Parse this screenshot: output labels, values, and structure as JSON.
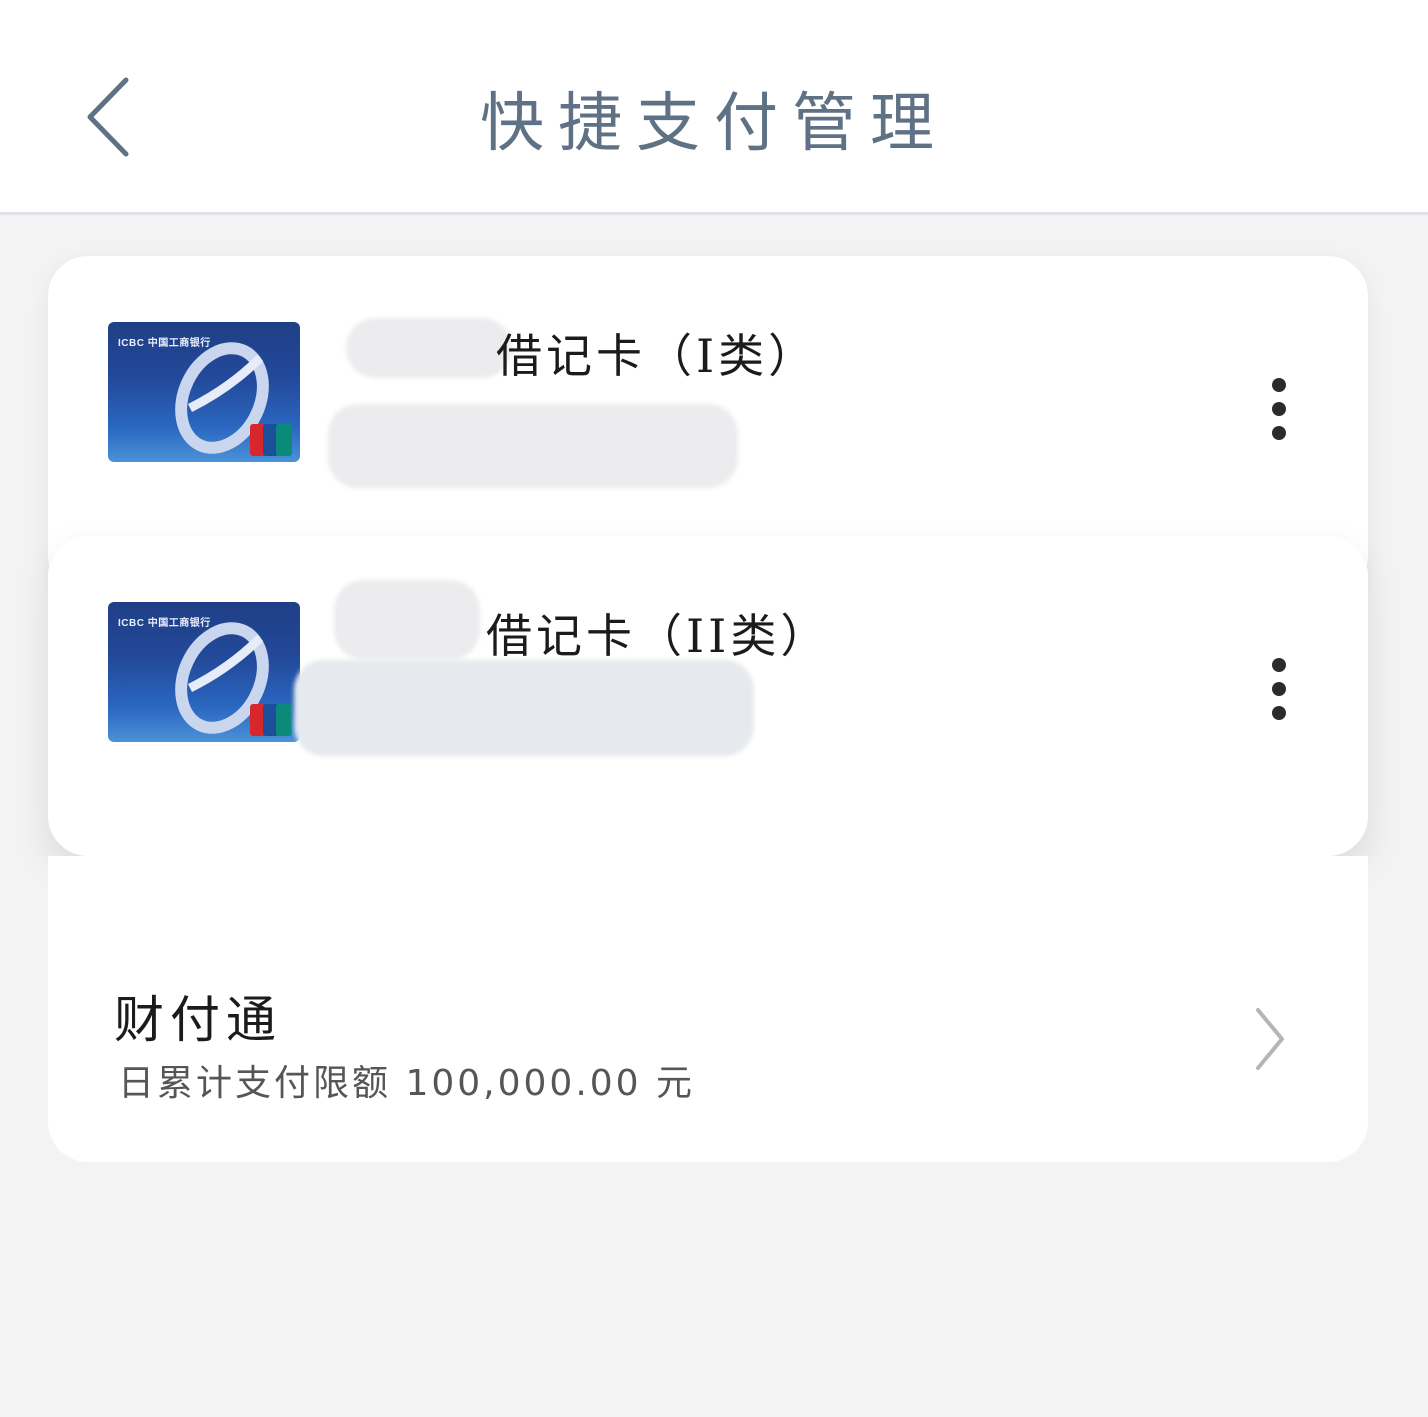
{
  "header": {
    "title": "快捷支付管理",
    "back_icon": "chevron-left-icon"
  },
  "cards": [
    {
      "name": "借记卡（I类）",
      "bank_brand": "ICBC 中国工商银行",
      "network": "UnionPay",
      "menu_icon": "more-vertical-icon"
    },
    {
      "name": "借记卡（II类）",
      "bank_brand": "ICBC 中国工商银行",
      "network": "UnionPay",
      "menu_icon": "more-vertical-icon"
    }
  ],
  "tenpay": {
    "title": "财付通",
    "limit_text": "日累计支付限额 100,000.00 元",
    "arrow_icon": "chevron-right-icon"
  },
  "colors": {
    "background": "#f3f3f3",
    "header_text": "#5e7185",
    "card_bg": "#ffffff",
    "card_blue": "#23499a"
  }
}
